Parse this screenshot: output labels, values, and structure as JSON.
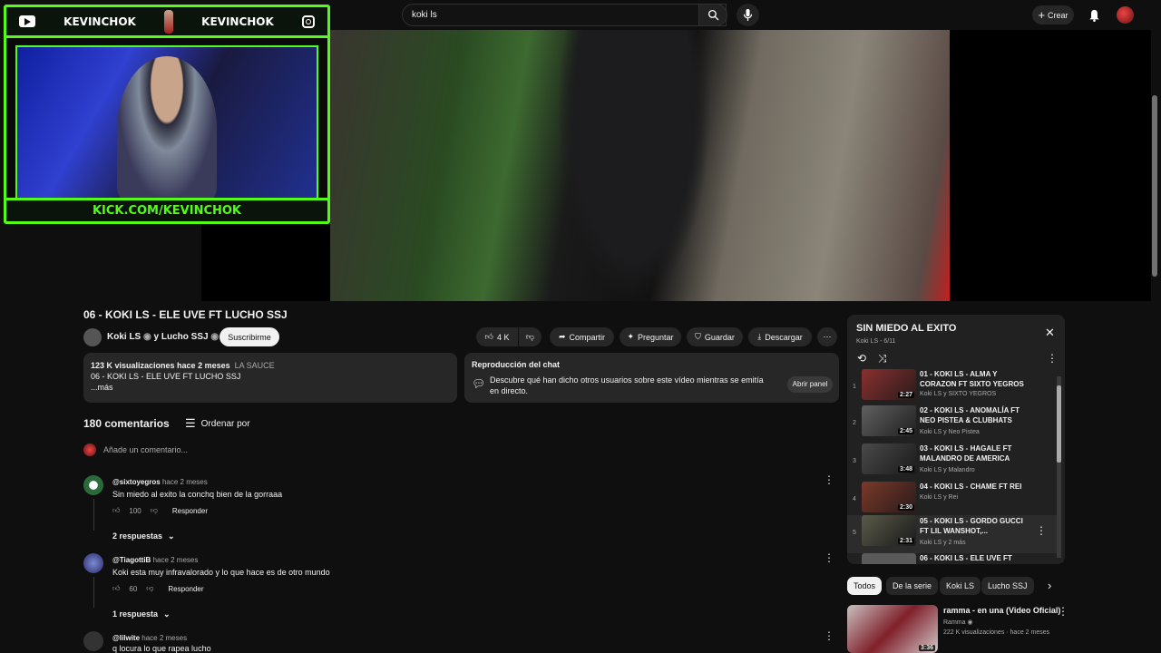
{
  "topbar": {
    "search_query": "koki ls",
    "create_label": "Crear"
  },
  "cam": {
    "name_left": "KEVINCHOK",
    "name_right": "KEVINCHOK",
    "footer": "KICK.COM/KEVINCHOK"
  },
  "video": {
    "title": "06 - KOKI LS - ELE UVE FT LUCHO SSJ",
    "channel": "Koki LS",
    "channel_sep": "y Lucho SSJ",
    "subscribe": "Suscribirme",
    "likes": "4 K",
    "share": "Compartir",
    "ask": "Preguntar",
    "save": "Guardar",
    "download": "Descargar"
  },
  "description": {
    "stats": "123 K visualizaciones  hace 2 meses",
    "tag": "LA SAUCE",
    "line": "06 - KOKI LS - ELE UVE FT LUCHO SSJ",
    "more": "...más"
  },
  "chat": {
    "heading": "Reproducción del chat",
    "text": "Descubre qué han dicho otros usuarios sobre este vídeo mientras se emitía en directo.",
    "open": "Abrir panel"
  },
  "comments": {
    "count": "180 comentarios",
    "sort": "Ordenar por",
    "placeholder": "Añade un comentario...",
    "reply_label": "Responder",
    "items": [
      {
        "user": "@sixtoyegros",
        "time": "hace 2 meses",
        "text": "Sin miedo al exito la conchq bien de la gorraaa",
        "likes": "100",
        "replies": "2 respuestas"
      },
      {
        "user": "@TiagottiB",
        "time": "hace 2 meses",
        "text": "Koki esta muy infravalorado y lo que hace es de otro mundo",
        "likes": "60",
        "replies": "1 respuesta"
      },
      {
        "user": "@lilwite",
        "time": "hace 2 meses",
        "text": "q locura lo que rapea lucho"
      }
    ]
  },
  "playlist": {
    "title": "SIN MIEDO AL EXITO",
    "subtitle": "Koki LS - 6/11",
    "items": [
      {
        "num": "1",
        "title": "01 - KOKI LS - ALMA Y CORAZON FT SIXTO YEGROS",
        "by": "Koki LS y SIXTO YEGROS",
        "dur": "2:27",
        "color": "#8a3030"
      },
      {
        "num": "2",
        "title": "02 - KOKI LS - ANOMALÍA FT NEO PISTEA & CLUBHATS",
        "by": "Koki LS y Neo Pistea",
        "dur": "2:45",
        "color": "#505050"
      },
      {
        "num": "3",
        "title": "03 - KOKI LS - HAGALE FT MALANDRO DE AMERICA",
        "by": "Koki LS y Malandro",
        "dur": "3:48",
        "color": "#3a3a3a"
      },
      {
        "num": "4",
        "title": "04 - KOKI LS - CHAME FT REI",
        "by": "Koki LS y Rei",
        "dur": "2:30",
        "color": "#7a3a2a"
      },
      {
        "num": "5",
        "title": "05 - KOKI LS - GORDO GUCCI FT LIL WANSHOT,...",
        "by": "Koki LS y 2 más",
        "dur": "2:31",
        "color": "#4a4a3a"
      },
      {
        "num": "",
        "title": "06 - KOKI LS - ELE UVE FT",
        "by": "",
        "dur": "",
        "color": "#5a5a5a"
      }
    ]
  },
  "chips": [
    "Todos",
    "De la serie",
    "Koki LS",
    "Lucho SSJ"
  ],
  "recommendation": {
    "title": "ramma - en una (Video Oficial)",
    "channel": "Ramma",
    "stats": "222 K visualizaciones · hace 2 meses",
    "duration": "3:36"
  }
}
